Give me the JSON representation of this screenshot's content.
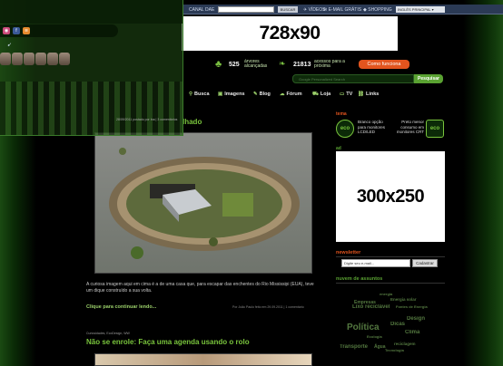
{
  "topbar": {
    "links": [
      "CANAL",
      "DAE"
    ],
    "search_button": "BUSCAR",
    "right_links": [
      "VÍDEOS",
      "E-MAIL GRÁTIS",
      "SHOPPING"
    ],
    "language": "INGLÊS PRINCIPAL"
  },
  "banner_ad": "728x90",
  "counters": {
    "trees_value": "525",
    "trees_label": "árvores alcançadas",
    "access_value": "21813",
    "access_label": "acessos para a próxima",
    "how_button": "Como funciona"
  },
  "search": {
    "placeholder": "Google Personalized Search",
    "button": "Pesquisar"
  },
  "nav": {
    "items": [
      "Busca",
      "Imagens",
      "Blog",
      "Fórum",
      "Loja",
      "TV",
      "Links"
    ]
  },
  "post1": {
    "title": "lhado",
    "meta": "30/09/2011 postado por Ina | 2 comentários",
    "image_alt": "Casa cercada por dique em área alagada",
    "text": "A curiosa imagem aqui em cima é a de uma casa que, para escapar das enchentes do Rio Mississipi (EUA), teve um dique construído a sua volta.",
    "read_more": "Clique para continuar lendo...",
    "byline": "Por João Paulo feito em 29.09.2011 | 1 comentário"
  },
  "post2": {
    "category": "Curiosidades, EcoDesign, WW",
    "title": "Não se enrole: Faça uma agenda usando o rolo"
  },
  "sidebar": {
    "label1": "tema",
    "eco1_logo": "eco",
    "eco1_text": [
      "Branco opção",
      "para monitores",
      "LCD/LED"
    ],
    "eco2_text": [
      "Preto menor",
      "consumo em",
      "monitores CRT"
    ],
    "eco2_logo": "eco",
    "label2": "ad",
    "ad300": "300x250",
    "newsletter_title": "newsletter",
    "newsletter_placeholder": "Digite seu e-mail...",
    "newsletter_button": "Cadastrar",
    "tags_title": "nuvem de assuntos",
    "tags": [
      "energia",
      "Energia solar",
      "Empresas",
      "Lixo reciclável",
      "Fontes de Energia",
      "Design",
      "Política",
      "Dicas",
      "Clima",
      "Ecologia",
      "Transporte",
      "Água",
      "reciclagem",
      "Tecnologia"
    ]
  },
  "overlay": {
    "caption": "28/09/2011 postado por Ina | 3 comentários"
  }
}
